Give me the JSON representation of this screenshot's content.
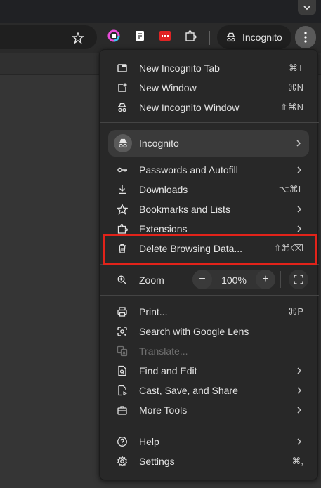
{
  "toolbar": {
    "profile_label": "Incognito"
  },
  "menu": {
    "group1": [
      {
        "label": "New Incognito Tab",
        "shortcut": "⌘T"
      },
      {
        "label": "New Window",
        "shortcut": "⌘N"
      },
      {
        "label": "New Incognito Window",
        "shortcut": "⇧⌘N"
      }
    ],
    "profile": {
      "label": "Incognito"
    },
    "group2": [
      {
        "label": "Passwords and Autofill"
      },
      {
        "label": "Downloads",
        "shortcut": "⌥⌘L"
      },
      {
        "label": "Bookmarks and Lists"
      },
      {
        "label": "Extensions"
      },
      {
        "label": "Delete Browsing Data...",
        "shortcut": "⇧⌘⌫"
      }
    ],
    "zoom": {
      "label": "Zoom",
      "value": "100%",
      "minus": "−",
      "plus": "+"
    },
    "group3": [
      {
        "label": "Print...",
        "shortcut": "⌘P"
      },
      {
        "label": "Search with Google Lens"
      },
      {
        "label": "Translate..."
      },
      {
        "label": "Find and Edit"
      },
      {
        "label": "Cast, Save, and Share"
      },
      {
        "label": "More Tools"
      }
    ],
    "group4": [
      {
        "label": "Help"
      },
      {
        "label": "Settings",
        "shortcut": "⌘,"
      }
    ]
  },
  "colors": {
    "highlight_box": "#e2231a",
    "menu_bg": "#282828"
  }
}
